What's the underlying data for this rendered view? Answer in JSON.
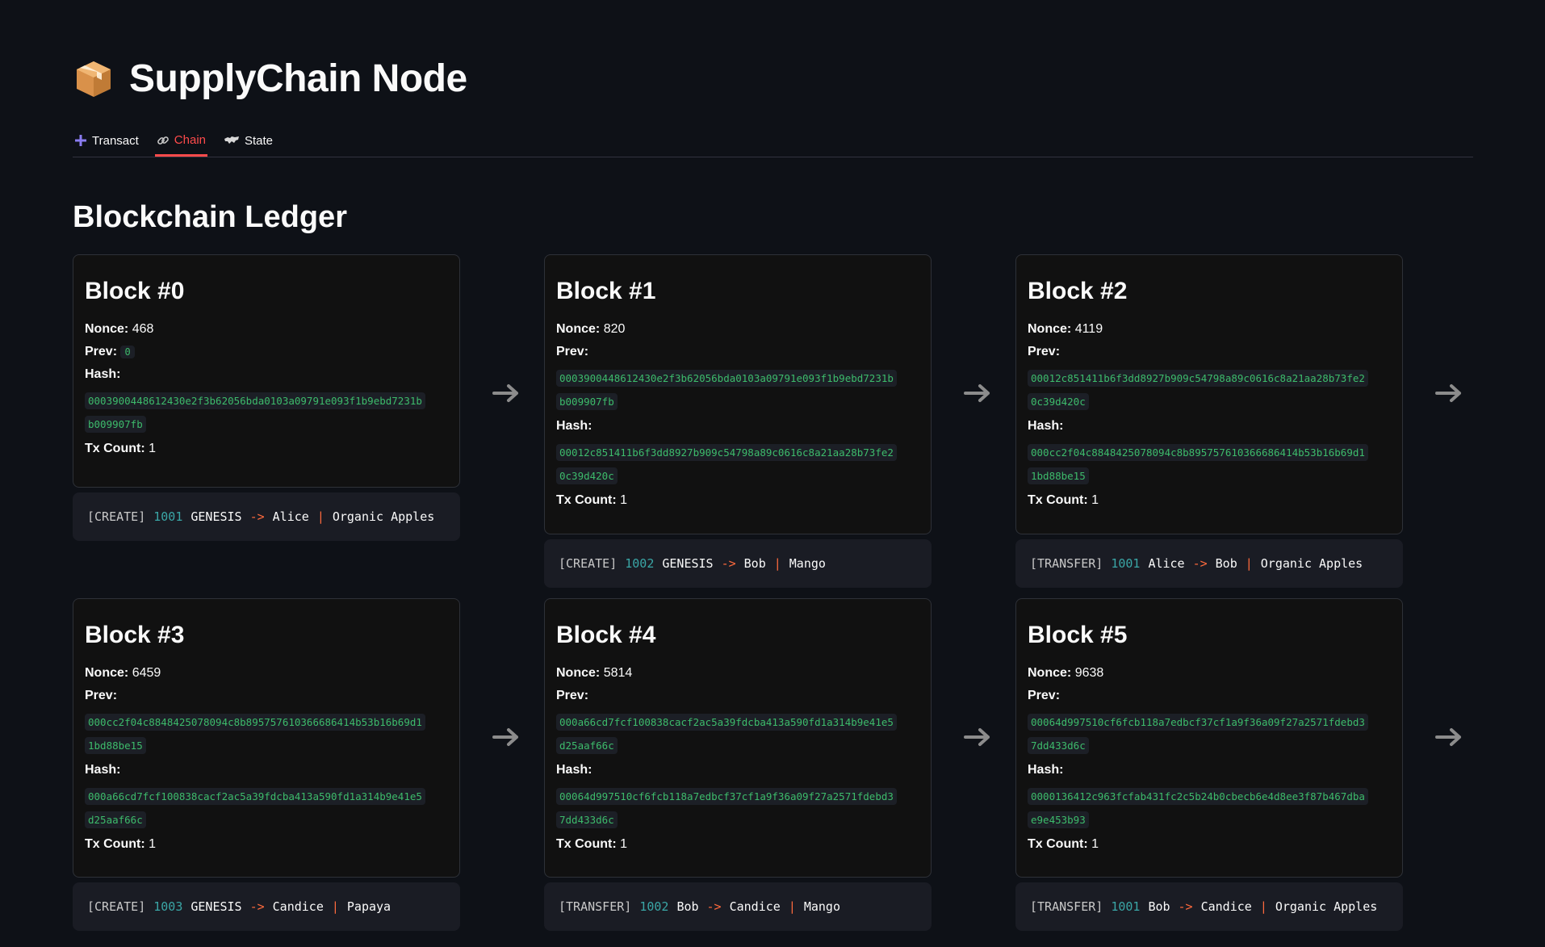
{
  "app": {
    "title": "SupplyChain Node",
    "title_icon": "package-icon"
  },
  "tabs": [
    {
      "label": "Transact",
      "icon": "plus-icon",
      "active": false
    },
    {
      "label": "Chain",
      "icon": "link-icon",
      "active": true
    },
    {
      "label": "State",
      "icon": "world-map-icon",
      "active": false
    }
  ],
  "section": {
    "title": "Blockchain Ledger"
  },
  "labels": {
    "nonce": "Nonce:",
    "prev": "Prev:",
    "hash": "Hash:",
    "tx_count": "Tx Count:"
  },
  "colors": {
    "accent": "#ff4b4b",
    "hash_green": "#3dbb6b",
    "arrow_orange": "#ff6a3d",
    "product_id_teal": "#3aa6a6",
    "background": "#0e1117"
  },
  "blocks": [
    {
      "title": "Block #0",
      "nonce": "468",
      "prev": "0",
      "hash_line1": "0003900448612430e2f3b62056bda0103a09791e093f1b9ebd7231b",
      "hash_line2": "b009907fb",
      "tx_count": "1",
      "tx": {
        "type": "[CREATE]",
        "product_id": "1001",
        "from": "GENESIS",
        "arrow": "->",
        "to": "Alice",
        "sep": "|",
        "product": "Organic Apples"
      }
    },
    {
      "title": "Block #1",
      "nonce": "820",
      "prev_line1": "0003900448612430e2f3b62056bda0103a09791e093f1b9ebd7231b",
      "prev_line2": "b009907fb",
      "hash_line1": "00012c851411b6f3dd8927b909c54798a89c0616c8a21aa28b73fe2",
      "hash_line2": "0c39d420c",
      "tx_count": "1",
      "tx": {
        "type": "[CREATE]",
        "product_id": "1002",
        "from": "GENESIS",
        "arrow": "->",
        "to": "Bob",
        "sep": "|",
        "product": "Mango"
      }
    },
    {
      "title": "Block #2",
      "nonce": "4119",
      "prev_line1": "00012c851411b6f3dd8927b909c54798a89c0616c8a21aa28b73fe2",
      "prev_line2": "0c39d420c",
      "hash_line1": "000cc2f04c8848425078094c8b895757610366686414b53b16b69d1",
      "hash_line2": "1bd88be15",
      "tx_count": "1",
      "tx": {
        "type": "[TRANSFER]",
        "product_id": "1001",
        "from": "Alice",
        "arrow": "->",
        "to": "Bob",
        "sep": "|",
        "product": "Organic Apples"
      }
    },
    {
      "title": "Block #3",
      "nonce": "6459",
      "prev_line1": "000cc2f04c8848425078094c8b895757610366686414b53b16b69d1",
      "prev_line2": "1bd88be15",
      "hash_line1": "000a66cd7fcf100838cacf2ac5a39fdcba413a590fd1a314b9e41e5",
      "hash_line2": "d25aaf66c",
      "tx_count": "1",
      "tx": {
        "type": "[CREATE]",
        "product_id": "1003",
        "from": "GENESIS",
        "arrow": "->",
        "to": "Candice",
        "sep": "|",
        "product": "Papaya"
      }
    },
    {
      "title": "Block #4",
      "nonce": "5814",
      "prev_line1": "000a66cd7fcf100838cacf2ac5a39fdcba413a590fd1a314b9e41e5",
      "prev_line2": "d25aaf66c",
      "hash_line1": "00064d997510cf6fcb118a7edbcf37cf1a9f36a09f27a2571fdebd3",
      "hash_line2": "7dd433d6c",
      "tx_count": "1",
      "tx": {
        "type": "[TRANSFER]",
        "product_id": "1002",
        "from": "Bob",
        "arrow": "->",
        "to": "Candice",
        "sep": "|",
        "product": "Mango"
      }
    },
    {
      "title": "Block #5",
      "nonce": "9638",
      "prev_line1": "00064d997510cf6fcb118a7edbcf37cf1a9f36a09f27a2571fdebd3",
      "prev_line2": "7dd433d6c",
      "hash_line1": "0000136412c963fcfab431fc2c5b24b0cbecb6e4d8ee3f87b467dba",
      "hash_line2": "e9e453b93",
      "tx_count": "1",
      "tx": {
        "type": "[TRANSFER]",
        "product_id": "1001",
        "from": "Bob",
        "arrow": "->",
        "to": "Candice",
        "sep": "|",
        "product": "Organic Apples"
      }
    }
  ]
}
